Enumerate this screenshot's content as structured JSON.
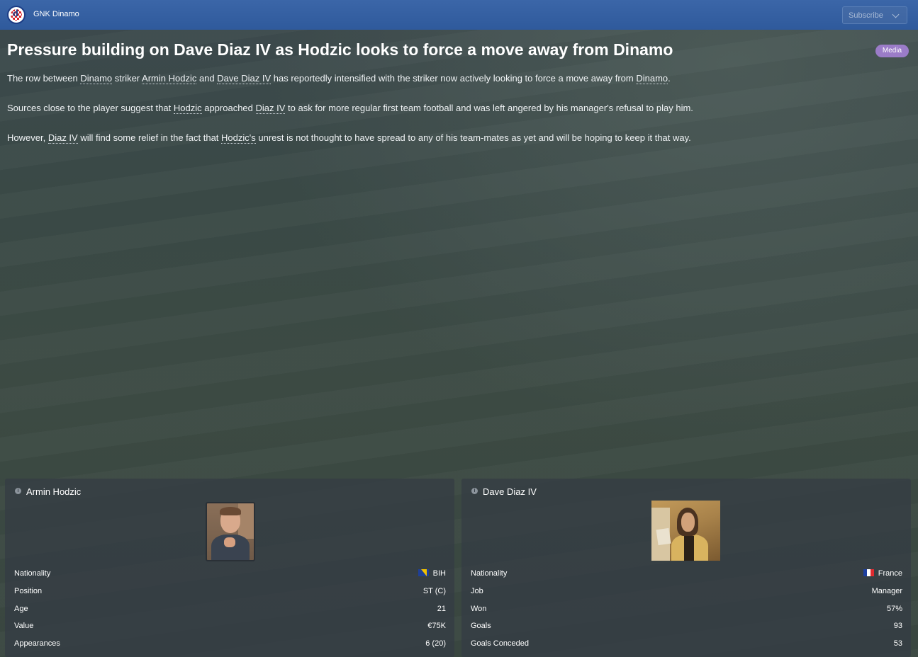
{
  "topbar": {
    "club_name": "GNK Dinamo",
    "logo_letter": "d",
    "subscribe_label": "Subscribe"
  },
  "article": {
    "headline": "Pressure building on Dave Diaz IV as Hodzic looks to force a move away from Dinamo",
    "tag": "Media",
    "p1": {
      "t1": "The row between ",
      "l1": "Dinamo",
      "t2": " striker ",
      "l2": "Armin Hodzic",
      "t3": " and ",
      "l3": "Dave Diaz IV",
      "t4": " has reportedly intensified with the striker now actively looking to force a move away from ",
      "l4": "Dinamo",
      "t5": "."
    },
    "p2": {
      "t1": "Sources close to the player suggest that ",
      "l1": "Hodzic",
      "t2": " approached ",
      "l2": "Diaz IV",
      "t3": " to ask for more regular first team football and was left angered by his manager's refusal to play him."
    },
    "p3": {
      "t1": "However, ",
      "l1": "Diaz IV",
      "t2": " will find some relief in the fact that ",
      "l2": "Hodzic's",
      "t3": " unrest is not thought to have spread to any of his team-mates as yet and will be hoping to keep it that way."
    }
  },
  "cards": {
    "player": {
      "name": "Armin Hodzic",
      "rows": [
        {
          "label": "Nationality",
          "value": "BIH",
          "flag": "bosnia-flag-icon"
        },
        {
          "label": "Position",
          "value": "ST (C)"
        },
        {
          "label": "Age",
          "value": "21"
        },
        {
          "label": "Value",
          "value": "€75K"
        },
        {
          "label": "Appearances",
          "value": "6 (20)"
        }
      ]
    },
    "manager": {
      "name": "Dave Diaz IV",
      "rows": [
        {
          "label": "Nationality",
          "value": "France",
          "flag": "france-flag-icon"
        },
        {
          "label": "Job",
          "value": "Manager"
        },
        {
          "label": "Won",
          "value": "57%"
        },
        {
          "label": "Goals",
          "value": "93"
        },
        {
          "label": "Goals Conceded",
          "value": "53"
        }
      ]
    }
  },
  "colors": {
    "topbar": "#2f5a9c",
    "tag": "#9b7cc8",
    "card_bg": "#343c44"
  }
}
